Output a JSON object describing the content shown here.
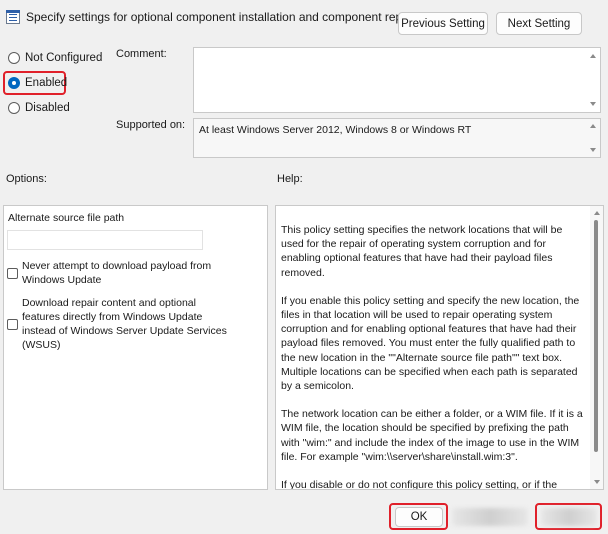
{
  "header": {
    "title": "Specify settings for optional component installation and component repair",
    "previous_label": "Previous Setting",
    "next_label": "Next Setting"
  },
  "state": {
    "options": [
      {
        "label": "Not Configured",
        "checked": false
      },
      {
        "label": "Enabled",
        "checked": true
      },
      {
        "label": "Disabled",
        "checked": false
      }
    ]
  },
  "comment": {
    "label": "Comment:",
    "value": ""
  },
  "supported": {
    "label": "Supported on:",
    "value": "At least Windows Server 2012, Windows 8 or Windows RT"
  },
  "options_panel": {
    "title": "Options:",
    "source_label": "Alternate source file path",
    "source_value": "",
    "checkbox1": "Never attempt to download payload from Windows Update",
    "checkbox2": "Download repair content and optional features directly from Windows Update instead of Windows Server Update Services (WSUS)"
  },
  "help_panel": {
    "title": "Help:",
    "p1": "This policy setting specifies the network locations that will be used for the repair of operating system corruption and for enabling optional features that have had their payload files removed.",
    "p2": "If you enable this policy setting and specify the new location, the files in that location will be used to repair operating system corruption and for enabling optional features that have had their payload files removed. You must enter the fully qualified path to the new location in the \"\"Alternate source file path\"\" text box. Multiple locations can be specified when each path is separated by a semicolon.",
    "p3": "The network location can be either a folder, or a WIM file. If it is a WIM file, the location should be specified by prefixing the path with \"wim:\" and include the index of the image to use in the WIM file. For example \"wim:\\\\server\\share\\install.wim:3\".",
    "p4": "If you disable or do not configure this policy setting, or if the"
  },
  "footer": {
    "ok_label": "OK"
  },
  "colors": {
    "accent": "#0067c0",
    "highlight": "#e0202a"
  }
}
